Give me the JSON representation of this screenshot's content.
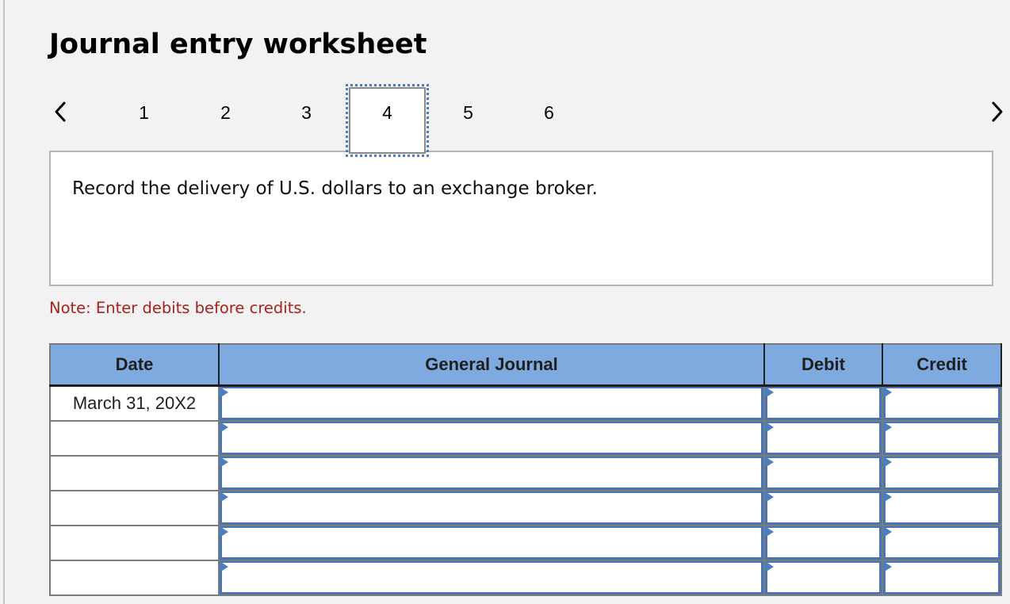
{
  "title": "Journal entry worksheet",
  "nav": {
    "prev_icon": "chevron-left-icon",
    "next_icon": "chevron-right-icon",
    "tabs": [
      {
        "label": "1",
        "active": false
      },
      {
        "label": "2",
        "active": false
      },
      {
        "label": "3",
        "active": false
      },
      {
        "label": "4",
        "active": true
      },
      {
        "label": "5",
        "active": false
      },
      {
        "label": "6",
        "active": false
      }
    ]
  },
  "description": "Record the delivery of U.S. dollars to an exchange broker.",
  "note": "Note: Enter debits before credits.",
  "table": {
    "headers": {
      "date": "Date",
      "general_journal": "General Journal",
      "debit": "Debit",
      "credit": "Credit"
    },
    "rows": [
      {
        "date": "March 31, 20X2",
        "account": "",
        "debit": "",
        "credit": ""
      },
      {
        "date": "",
        "account": "",
        "debit": "",
        "credit": ""
      },
      {
        "date": "",
        "account": "",
        "debit": "",
        "credit": ""
      },
      {
        "date": "",
        "account": "",
        "debit": "",
        "credit": ""
      },
      {
        "date": "",
        "account": "",
        "debit": "",
        "credit": ""
      },
      {
        "date": "",
        "account": "",
        "debit": "",
        "credit": ""
      }
    ]
  },
  "colors": {
    "header_bg": "#7faadf",
    "note_red": "#a6221c",
    "input_border_blue": "#4a75b3",
    "active_tab_outline": "#4a7ec2"
  }
}
